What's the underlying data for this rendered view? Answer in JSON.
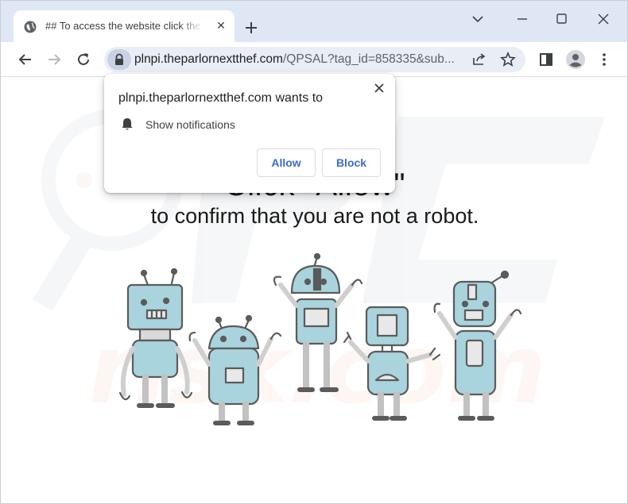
{
  "tab": {
    "title": "## To access the website click the",
    "favicon": "globe-icon"
  },
  "window_controls": [
    "chevron-down-icon",
    "minimize-icon",
    "maximize-icon",
    "close-icon"
  ],
  "toolbar": {
    "url_host": "plnpi.theparlornextthef.com",
    "url_path": "/QPSAL?tag_id=858335&sub...",
    "icons": [
      "back-icon",
      "forward-icon",
      "reload-icon",
      "lock-icon",
      "share-icon",
      "star-icon",
      "sidepanel-icon",
      "profile-icon",
      "menu-icon"
    ]
  },
  "popup": {
    "title": "plnpi.theparlornextthef.com wants to",
    "permission": "Show notifications",
    "allow_label": "Allow",
    "block_label": "Block"
  },
  "page": {
    "heading": "Click \"Allow\"",
    "subheading": "to confirm that you are not a robot."
  },
  "colors": {
    "tabstrip": "#dfe7f5",
    "omnibox": "#e9eef6",
    "button_text": "#3c6ad0",
    "robot_fill": "#a9d3dd",
    "robot_stroke": "#5b5b5b"
  }
}
